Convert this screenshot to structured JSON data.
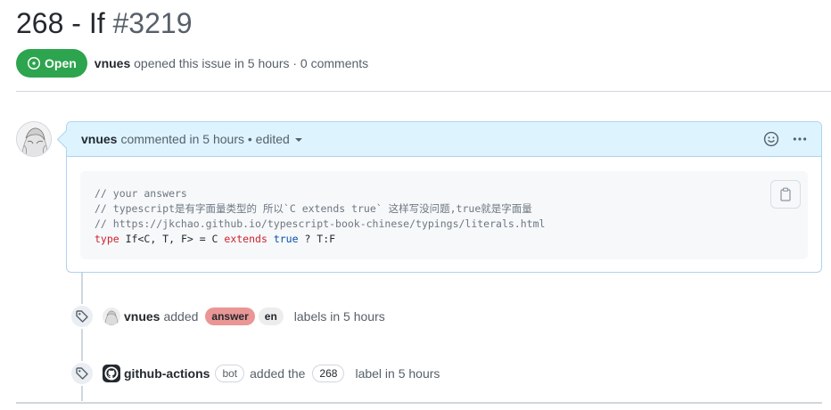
{
  "issue": {
    "title": "268 - If",
    "number": "#3219",
    "state": "Open",
    "author": "vnues",
    "meta_text": "opened this issue in 5 hours · 0 comments"
  },
  "comment": {
    "author": "vnues",
    "meta": "commented in 5 hours • edited",
    "code": {
      "line1": "// your answers",
      "line2": "// typescript是有字面量类型的 所以`C extends true` 这样写没问题,true就是字面量",
      "line3": "// https://jkchao.github.io/typescript-book-chinese/typings/literals.html",
      "line4_kw1": "type",
      "line4_a": " If<C, T, F> = C ",
      "line4_kw2": "extends",
      "line4_b": " ",
      "line4_true": "true",
      "line4_c": " ? T:F"
    }
  },
  "timeline": [
    {
      "actor": "vnues",
      "verb": "added",
      "labels": [
        "answer",
        "en"
      ],
      "suffix": "labels in 5 hours"
    },
    {
      "actor": "github-actions",
      "badge": "bot",
      "verb": "added the",
      "labels": [
        "268"
      ],
      "suffix": "label in 5 hours"
    }
  ],
  "colors": {
    "open_green": "#2da44e",
    "comment_header_blue": "#ddf4ff",
    "label_answer": "#e99695",
    "label_en": "#ededed"
  },
  "icons": {
    "state": "issue-opened-icon",
    "reaction": "smiley-icon",
    "more": "kebab-horizontal-icon",
    "copy": "copy-icon",
    "event": "tag-icon"
  }
}
